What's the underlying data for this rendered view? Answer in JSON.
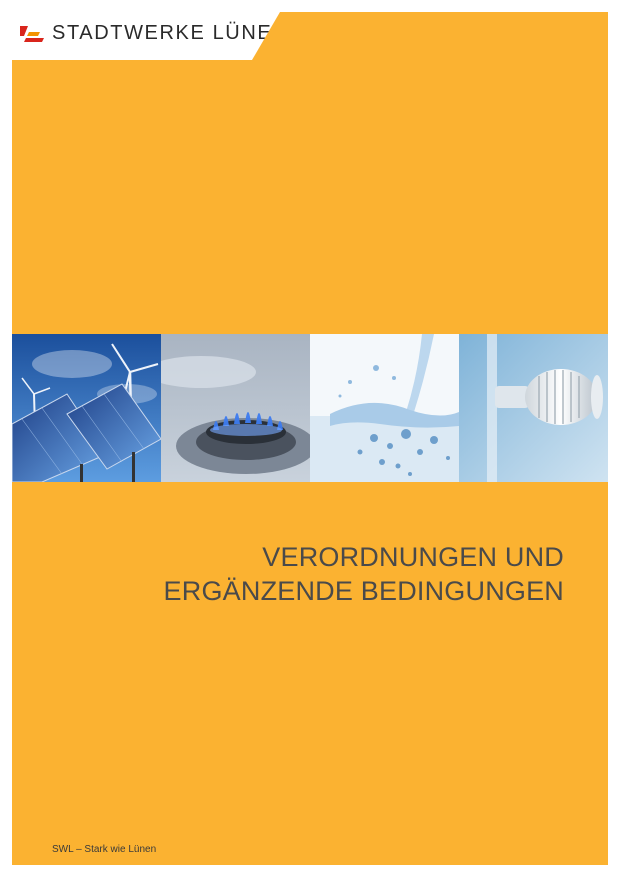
{
  "brand": {
    "name": "STADTWERKE LÜNEN",
    "colors": {
      "primary": "#fbb231",
      "logo_red": "#d9251c",
      "logo_orange": "#f39200"
    }
  },
  "photos": [
    {
      "label": "solar-wind-photo"
    },
    {
      "label": "gas-flame-photo"
    },
    {
      "label": "water-splash-photo"
    },
    {
      "label": "radiator-thermostat-photo"
    }
  ],
  "title": {
    "line1": "VERORDNUNGEN UND",
    "line2": "ERGÄNZENDE BEDINGUNGEN"
  },
  "footer": {
    "tagline": "SWL – Stark wie Lünen"
  }
}
